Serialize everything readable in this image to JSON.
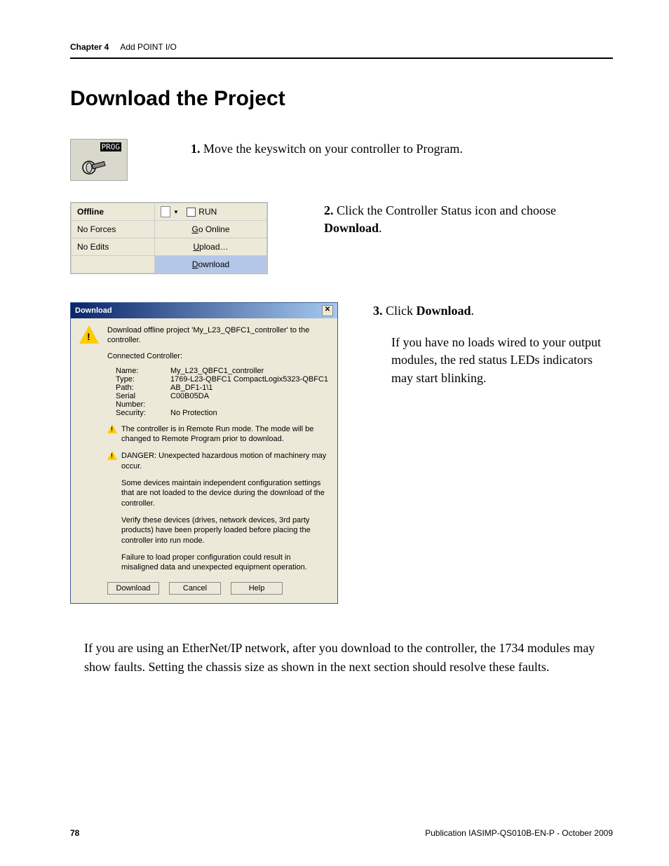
{
  "header": {
    "chapter_label": "Chapter 4",
    "chapter_title": "Add POINT I/O"
  },
  "section_title": "Download the Project",
  "prog_icon": {
    "label": "PROG"
  },
  "step1": {
    "num": "1.",
    "text": "Move the keyswitch on your controller to Program."
  },
  "status_widget": {
    "offline": "Offline",
    "run": "RUN",
    "no_forces": "No Forces",
    "go_online_pre": "G",
    "go_online_post": "o Online",
    "no_edits": "No Edits",
    "upload_pre": "U",
    "upload_post": "pload…",
    "download_pre": "D",
    "download_post": "ownload"
  },
  "step2": {
    "num": "2.",
    "text_a": "Click the Controller Status icon and choose ",
    "text_b": "Download",
    "text_c": "."
  },
  "dialog": {
    "title": "Download",
    "intro": "Download offline project 'My_L23_QBFC1_controller' to the controller.",
    "connected_label": "Connected Controller:",
    "fields": {
      "name_lbl": "Name:",
      "name_val": "My_L23_QBFC1_controller",
      "type_lbl": "Type:",
      "type_val": "1769-L23-QBFC1 CompactLogix5323-QBFC1",
      "path_lbl": "Path:",
      "path_val": "AB_DF1-1\\1",
      "serial_lbl": "Serial Number:",
      "serial_val": "C00B05DA",
      "security_lbl": "Security:",
      "security_val": "No Protection"
    },
    "warn1": "The controller is in Remote Run mode. The mode will be changed to Remote Program prior to download.",
    "warn2": "DANGER: Unexpected hazardous motion of machinery may occur.",
    "note1": "Some devices maintain independent configuration settings that are not loaded to the device during the download of the controller.",
    "note2": "Verify these devices (drives, network devices, 3rd party products) have been properly loaded before placing the controller into run mode.",
    "note3": "Failure to load proper configuration could result in misaligned data and unexpected equipment operation.",
    "buttons": {
      "download": "Download",
      "cancel": "Cancel",
      "help": "Help"
    }
  },
  "step3": {
    "num": "3.",
    "text_a": "Click ",
    "text_b": "Download",
    "text_c": ".",
    "para": "If you have no loads wired to your output modules, the red status LEDs indicators may start blinking."
  },
  "closing_para": "If you are using an EtherNet/IP network, after you download to the controller, the 1734 modules may show faults. Setting the chassis size as shown in the next section should resolve these faults.",
  "footer": {
    "page": "78",
    "pub": "Publication IASIMP-QS010B-EN-P - October 2009"
  }
}
